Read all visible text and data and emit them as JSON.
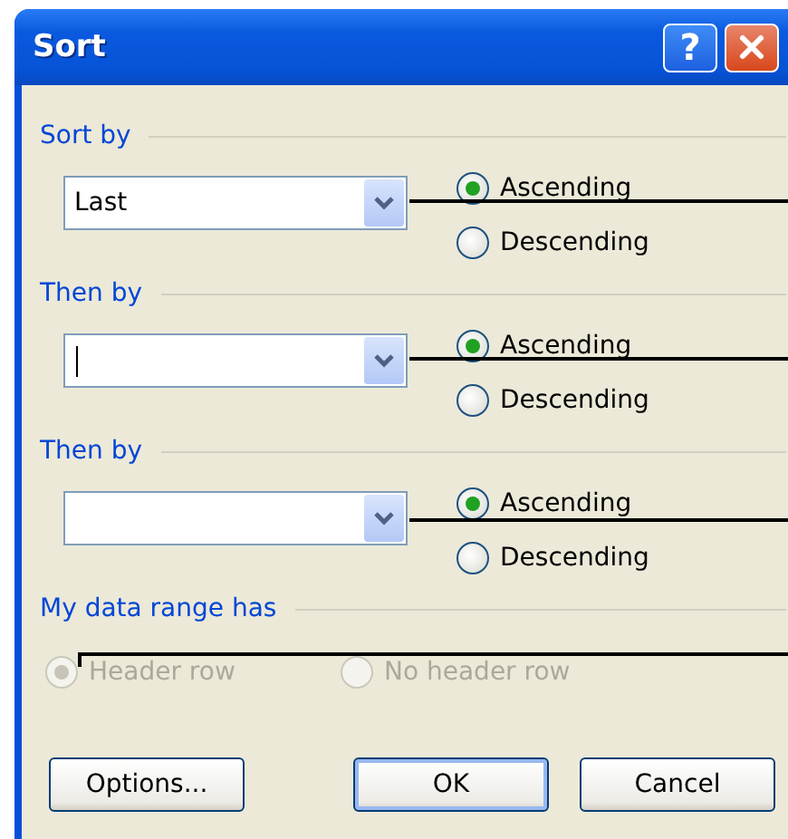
{
  "window": {
    "title": "Sort",
    "help": "?"
  },
  "sort_levels": [
    {
      "heading": "Sort by",
      "value": "Last",
      "focused": false,
      "order": [
        {
          "label": "Ascending",
          "selected": true
        },
        {
          "label": "Descending",
          "selected": false
        }
      ]
    },
    {
      "heading": "Then by",
      "focused": true,
      "order": [
        {
          "label": "Ascending",
          "selected": true
        },
        {
          "label": "Descending",
          "selected": false
        }
      ]
    },
    {
      "heading": "Then by",
      "focused": false,
      "order": [
        {
          "label": "Ascending",
          "selected": true
        },
        {
          "label": "Descending",
          "selected": false
        }
      ]
    }
  ],
  "header_options": {
    "heading": "My data range has",
    "disabled": true,
    "options": [
      {
        "label": "Header row",
        "selected": true
      },
      {
        "label": "No header row",
        "selected": false
      }
    ]
  },
  "buttons": [
    {
      "label": "Options...",
      "default": false
    },
    {
      "label": "OK",
      "default": true
    },
    {
      "label": "Cancel",
      "default": false
    }
  ]
}
